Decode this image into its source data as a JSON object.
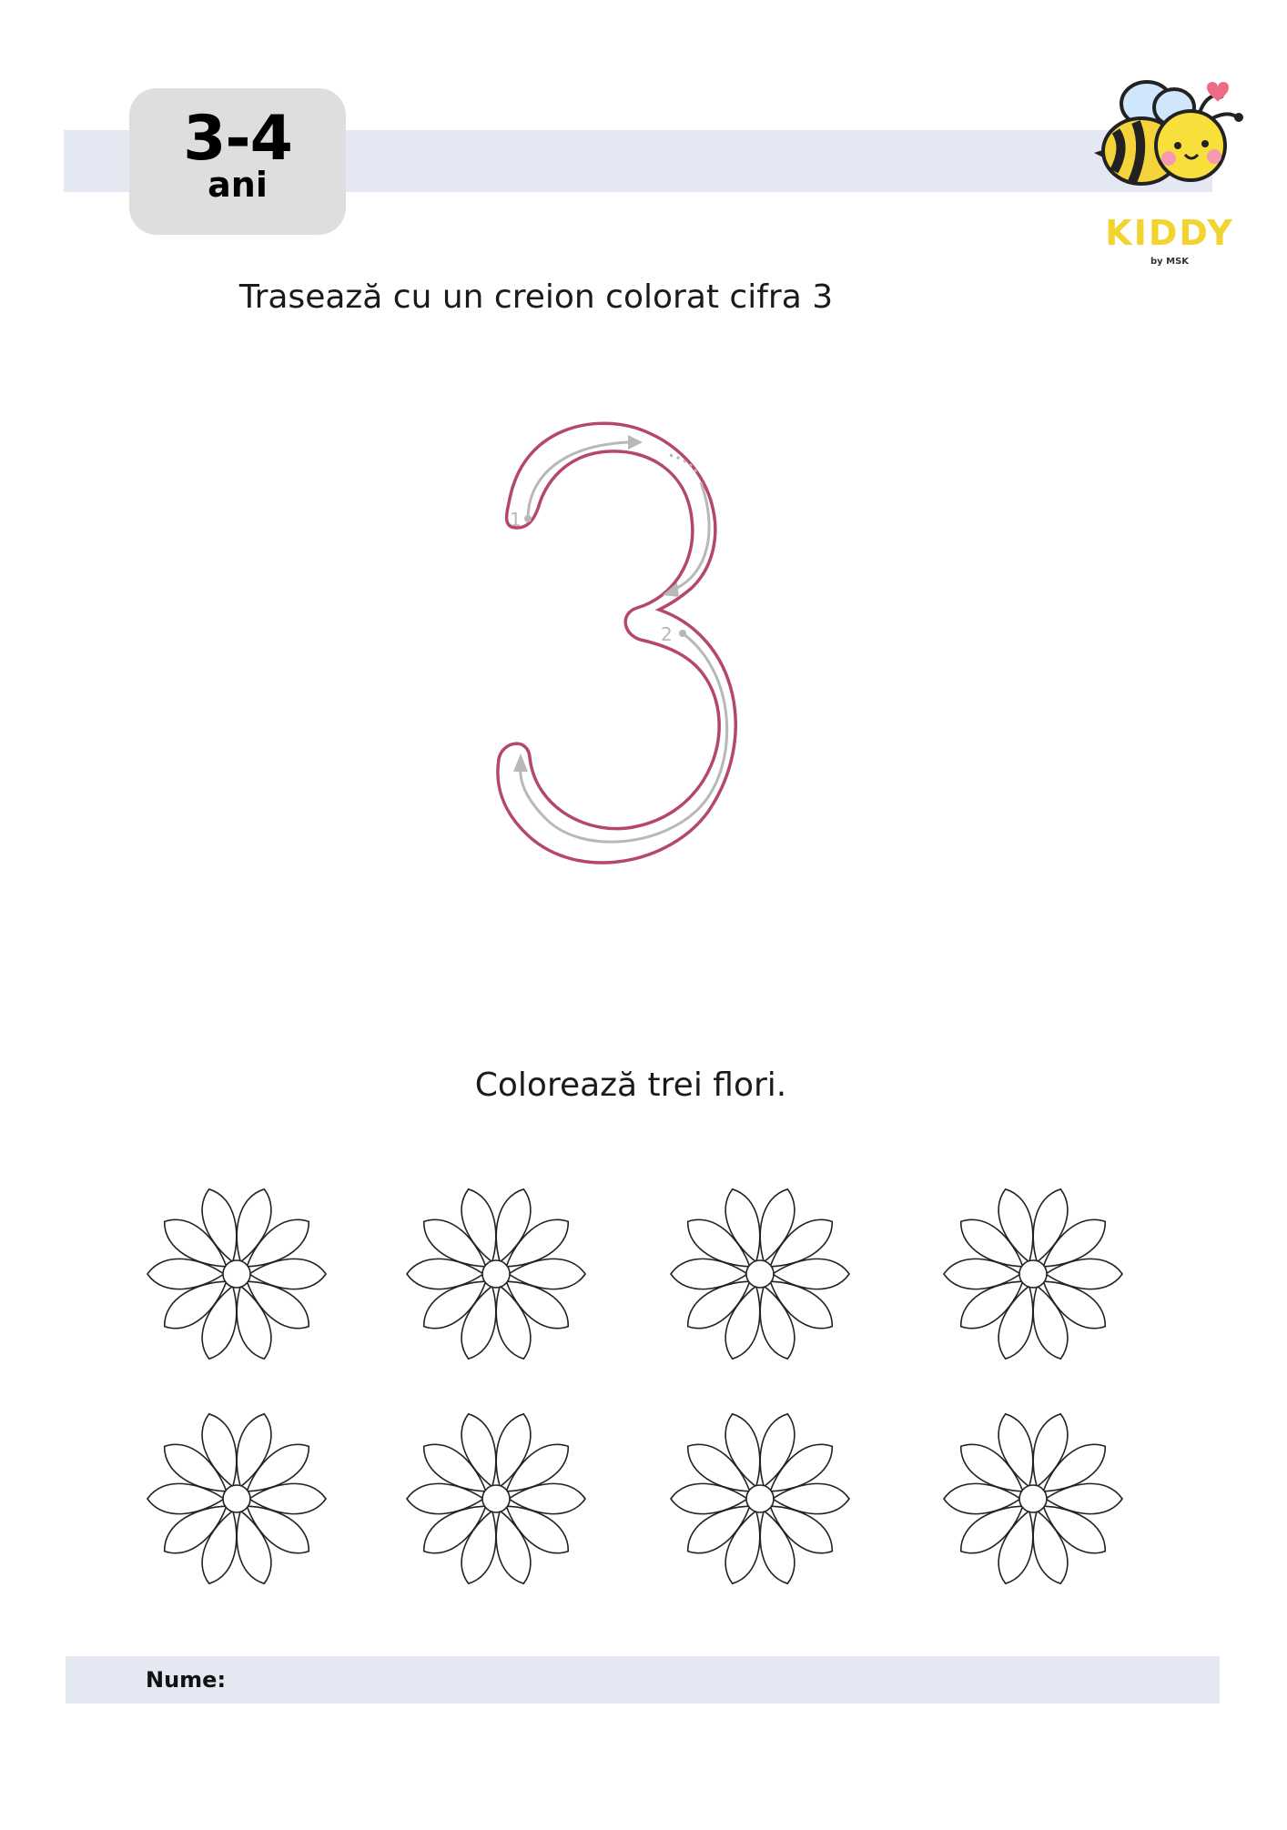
{
  "header": {
    "age_range": "3-4",
    "age_unit": "ani"
  },
  "brand": {
    "name": "KIDDY",
    "subtitle": "by MSK",
    "name_color": "#f2d431",
    "mascot_icon": "bee-icon"
  },
  "tracing": {
    "instruction": "Trasează cu un creion colorat cifra 3",
    "digit": "3",
    "stroke_labels": [
      "1",
      "2"
    ],
    "outline_color": "#b5486a",
    "guide_color": "#b8b8b8"
  },
  "coloring": {
    "instruction": "Colorează trei flori.",
    "flower_count": 8,
    "rows": 2,
    "columns": 4,
    "flower_icon": "daisy-icon"
  },
  "footer": {
    "name_label": "Nume:",
    "name_value": ""
  },
  "colors": {
    "band": "#e4e8f2",
    "badge": "#dedede"
  }
}
